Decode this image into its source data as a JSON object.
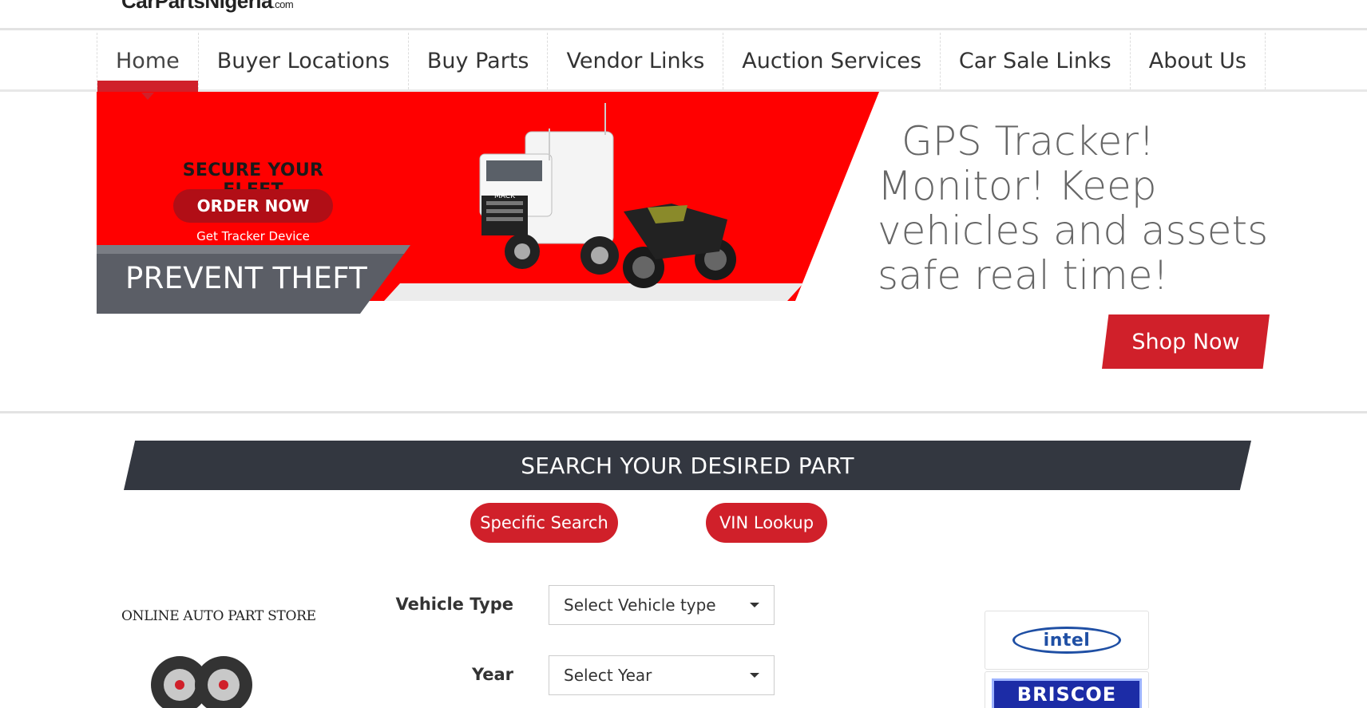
{
  "site": {
    "logo": "CarPartsNigeria",
    "logo_suffix": ".com"
  },
  "nav": {
    "items": [
      {
        "label": "Home",
        "active": true
      },
      {
        "label": "Buyer Locations"
      },
      {
        "label": "Buy Parts"
      },
      {
        "label": "Vendor Links"
      },
      {
        "label": "Auction Services"
      },
      {
        "label": "Car Sale Links"
      },
      {
        "label": "About Us"
      }
    ]
  },
  "hero": {
    "banner": {
      "title": "SECURE YOUR FLEET",
      "order_button": "ORDER NOW",
      "note": "Get Tracker Device",
      "tagline": "PREVENT THEFT",
      "truck_brand": "MACK"
    },
    "headline_lines": [
      "GPS Tracker!",
      "Monitor! Keep",
      "vehicles and assets",
      "safe real time!"
    ],
    "shop_button": "Shop Now"
  },
  "search": {
    "title": "SEARCH YOUR DESIRED PART",
    "tabs": [
      "Specific Search",
      "VIN Lookup"
    ],
    "store_label": "ONLINE AUTO PART STORE",
    "fields": {
      "vehicle_type": {
        "label": "Vehicle Type",
        "value": "Select Vehicle type"
      },
      "year": {
        "label": "Year",
        "value": "Select Year"
      }
    },
    "brands": [
      "intel",
      "BRISCOE"
    ]
  },
  "colors": {
    "accent": "#d0202a",
    "dark": "#333740",
    "banner_red": "#ff0000"
  }
}
